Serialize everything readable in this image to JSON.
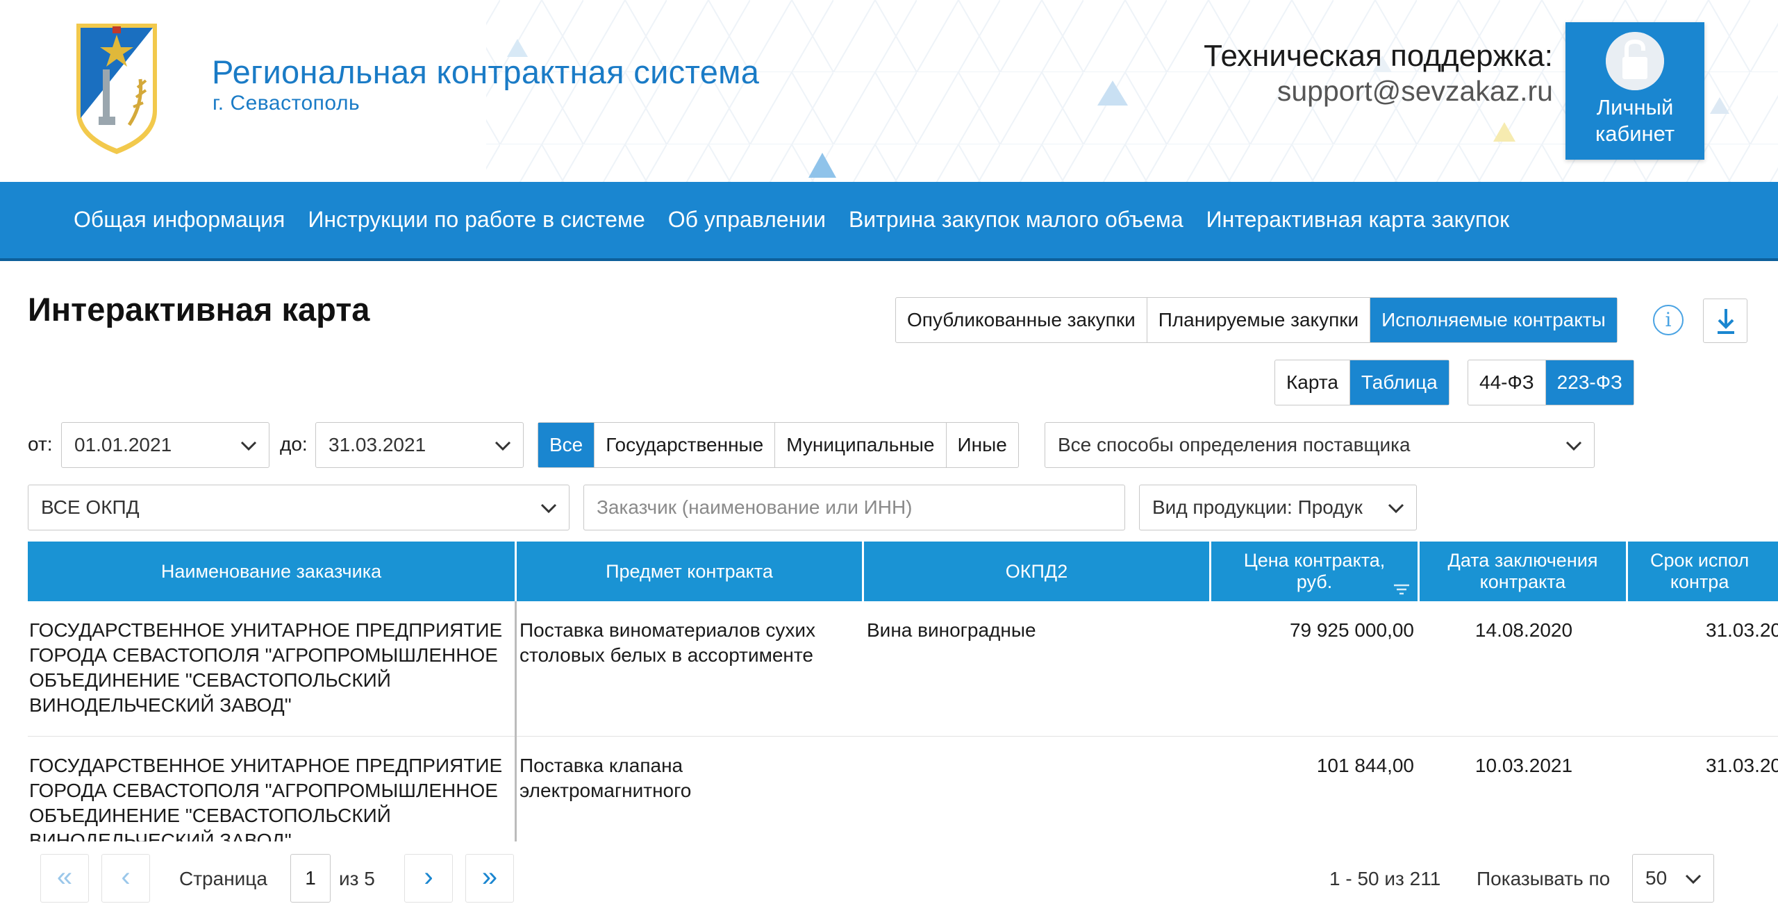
{
  "header": {
    "title": "Региональная контрактная система",
    "subtitle": "г. Севастополь",
    "support_label": "Техническая поддержка:",
    "support_email": "support@sevzakaz.ru",
    "cabinet_label": "Личный\nкабинет",
    "colors": {
      "brand": "#1a86d0",
      "pattern_blue": "#8fc3ea",
      "pattern_yellow": "#f3e28a"
    }
  },
  "nav": {
    "items": [
      "Общая информация",
      "Инструкции по работе в системе",
      "Об управлении",
      "Витрина закупок малого объема",
      "Интерактивная карта закупок"
    ]
  },
  "page": {
    "title": "Интерактивная карта",
    "procurement_tabs": [
      "Опубликованные закупки",
      "Планируемые закупки",
      "Исполняемые контракты"
    ],
    "procurement_active": "Исполняемые контракты",
    "info_icon": "info-icon",
    "download_icon": "download-icon",
    "view_tabs": [
      "Карта",
      "Таблица"
    ],
    "view_active": "Таблица",
    "law_tabs": [
      "44-ФЗ",
      "223-ФЗ"
    ],
    "law_active": "223-ФЗ"
  },
  "filters": {
    "from_label": "от:",
    "from_value": "01.01.2021",
    "to_label": "до:",
    "to_value": "31.03.2021",
    "type_tabs": [
      "Все",
      "Государственные",
      "Муниципальные",
      "Иные"
    ],
    "type_active": "Все",
    "method_value": "Все способы определения поставщика",
    "okpd_value": "ВСЕ ОКПД",
    "customer_placeholder": "Заказчик (наименование или ИНН)",
    "product_value": "Вид продукции: Продук"
  },
  "table": {
    "columns": [
      "Наименование заказчика",
      "Предмет контракта",
      "ОКПД2",
      "Цена контракта,\nруб.",
      "Дата заключения\nконтракта",
      "Срок испол\nконтра"
    ],
    "rows": [
      {
        "customer": "ГОСУДАРСТВЕННОЕ УНИТАРНОЕ ПРЕДПРИЯТИЕ ГОРОДА СЕВАСТОПОЛЯ \"АГРОПРОМЫШЛЕННОЕ ОБЪЕДИНЕНИЕ \"СЕВАСТОПОЛЬСКИЙ ВИНОДЕЛЬЧЕСКИЙ ЗАВОД\"",
        "subject": "Поставка виноматериалов сухих столовых белых в ассортименте",
        "okpd": "Вина виноградные",
        "price": "79 925 000,00",
        "date": "14.08.2020",
        "term": "31.03.20"
      },
      {
        "customer": "ГОСУДАРСТВЕННОЕ УНИТАРНОЕ ПРЕДПРИЯТИЕ ГОРОДА СЕВАСТОПОЛЯ \"АГРОПРОМЫШЛЕННОЕ ОБЪЕДИНЕНИЕ \"СЕВАСТОПОЛЬСКИЙ ВИНОДЕЛЬЧЕСКИЙ ЗАВОД\"",
        "subject": "Поставка клапана электромагнитного",
        "okpd": "",
        "price": "101 844,00",
        "date": "10.03.2021",
        "term": "31.03.20"
      }
    ]
  },
  "pager": {
    "first": "«",
    "prev": "‹",
    "next": "›",
    "last": "»",
    "page_label": "Страница",
    "page_value": "1",
    "of_label": "из 5",
    "range": "1 - 50 из 211",
    "per_page_label": "Показывать по",
    "per_page_value": "50"
  }
}
